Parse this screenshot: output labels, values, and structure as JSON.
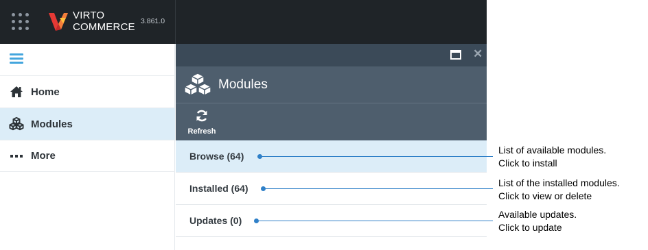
{
  "header": {
    "brand_line1": "VIRTO",
    "brand_line2": "COMMERCE",
    "version": "3.861.0",
    "grid_icon": "apps-grid-icon",
    "logo_icon": "virto-logo-icon"
  },
  "sidebar": {
    "menu_icon": "hamburger-icon",
    "items": [
      {
        "label": "Home",
        "icon": "home-icon"
      },
      {
        "label": "Modules",
        "icon": "cubes-icon",
        "active": true
      },
      {
        "label": "More",
        "icon": "more-dots-icon"
      }
    ]
  },
  "blade": {
    "title": "Modules",
    "title_icon": "cubes-icon",
    "toolbar": {
      "refresh_label": "Refresh",
      "refresh_icon": "refresh-icon"
    },
    "window_controls": {
      "maximize_icon": "maximize-icon",
      "close_icon": "close-icon"
    },
    "list": [
      {
        "label": "Browse (64)",
        "active": true
      },
      {
        "label": "Installed (64)"
      },
      {
        "label": "Updates (0)"
      }
    ]
  },
  "callouts": [
    {
      "line1": "List of available modules.",
      "line2": "Click to install"
    },
    {
      "line1": "List of the installed modules.",
      "line2": "Click to view or delete"
    },
    {
      "line1": "Available updates.",
      "line2": "Click to update"
    }
  ],
  "colors": {
    "topbar": "#1f2428",
    "blade_header": "#4e5e6d",
    "active_row": "#dcedf8",
    "accent": "#43a5dd",
    "callout": "#2f80c8",
    "logo_orange": "#f37e3b",
    "logo_red": "#e53935"
  }
}
